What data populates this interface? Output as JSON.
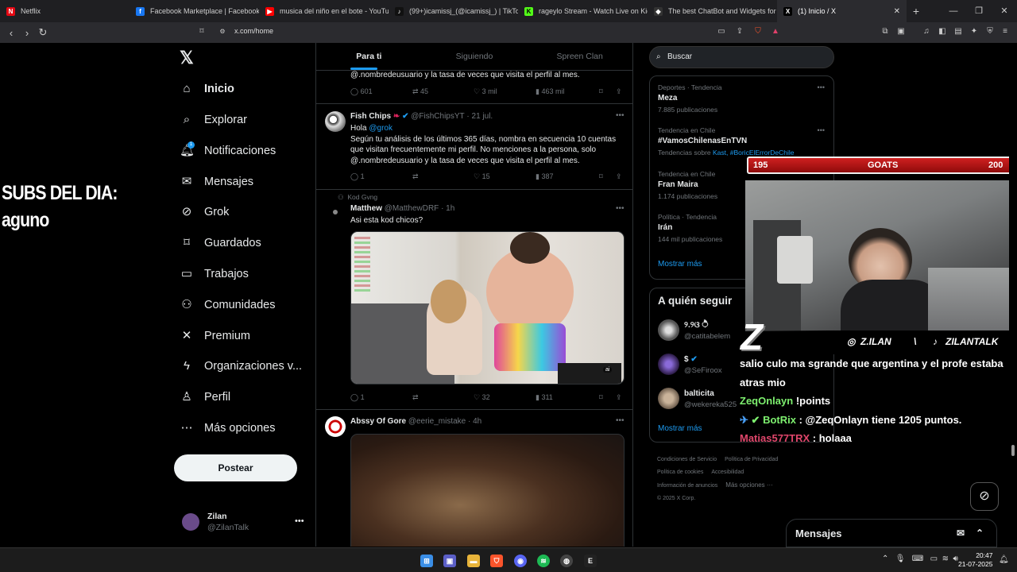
{
  "browser": {
    "tabs": [
      {
        "label": "Netflix",
        "icon": "netflix-icon",
        "color": "#e50914",
        "glyph": "N"
      },
      {
        "label": "Facebook Marketplace | Facebook",
        "icon": "facebook-icon",
        "color": "#1877f2",
        "glyph": "f"
      },
      {
        "label": "musica del niño en el bote - YouTube",
        "icon": "youtube-icon",
        "color": "#ff0000",
        "glyph": "▶"
      },
      {
        "label": "(99+)icamissj_(@icamissj_) | TikTok",
        "icon": "tiktok-icon",
        "color": "#111111",
        "glyph": "♪"
      },
      {
        "label": "rageylo Stream - Watch Live on Kick",
        "icon": "kick-icon",
        "color": "#53fc18",
        "glyph": "K"
      },
      {
        "label": "The best ChatBot and Widgets for Kick",
        "icon": "botrix-icon",
        "color": "#333333",
        "glyph": "◆"
      },
      {
        "label": "(1) Inicio / X",
        "icon": "x-icon",
        "color": "#000000",
        "glyph": "𝕏"
      }
    ],
    "url": "x.com/home"
  },
  "overlay": {
    "subs_line1": "SUBS DEL DIA:",
    "subs_line2": "aguno",
    "goat_left": "195",
    "goat_label": "GOATS",
    "goat_right": "200",
    "instagram": "Z.ILAN",
    "separator": "\\",
    "tiktok": "ZILANTALK",
    "z_logo": "Z",
    "chat": [
      {
        "user": "",
        "user_color": "#ffffff",
        "text": "salio culo ma sgrande que argentina y el profe estaba"
      },
      {
        "user": "",
        "user_color": "#ffffff",
        "text": "atras mio"
      },
      {
        "user": "ZeqOnlayn",
        "user_color": "#7ef06f",
        "text": "!points"
      },
      {
        "user": "BotRix",
        "user_color": "#7ef06f",
        "text": ": @ZeqOnlayn tiene 1205 puntos."
      },
      {
        "user": "Matias577TRX",
        "user_color": "#e0466b",
        "text": ": holaaa"
      }
    ]
  },
  "nav": {
    "items": [
      {
        "label": "Inicio",
        "icon": "home-icon"
      },
      {
        "label": "Explorar",
        "icon": "search-icon"
      },
      {
        "label": "Notificaciones",
        "icon": "bell-icon"
      },
      {
        "label": "Mensajes",
        "icon": "mail-icon"
      },
      {
        "label": "Grok",
        "icon": "grok-icon"
      },
      {
        "label": "Guardados",
        "icon": "bookmark-icon"
      },
      {
        "label": "Trabajos",
        "icon": "briefcase-icon"
      },
      {
        "label": "Comunidades",
        "icon": "people-icon"
      },
      {
        "label": "Premium",
        "icon": "x-icon"
      },
      {
        "label": "Organizaciones v...",
        "icon": "lightning-icon"
      },
      {
        "label": "Perfil",
        "icon": "person-icon"
      },
      {
        "label": "Más opciones",
        "icon": "more-icon"
      }
    ],
    "notif_badge": "1",
    "post_label": "Postear",
    "account_name": "Zilan",
    "account_handle": "@ZilanTalk"
  },
  "timeline": {
    "tabs": [
      "Para ti",
      "Siguiendo",
      "Spreen Clan"
    ],
    "tweet0": {
      "text": "@.nombredeusuario y la tasa de veces que visita el perfil al mes.",
      "replies": "601",
      "retweets": "45",
      "likes": "3 mil",
      "views": "463 mil"
    },
    "tweet1": {
      "name": "Fish Chips",
      "handle": "@FishChipsYT",
      "time": "· 21 jul.",
      "line1_prefix": "Hola ",
      "line1_mention": "@grok",
      "body": "Según tu análisis de los últimos 365 días, nombra en secuencia 10 cuentas que visitan frecuentemente mi perfil. No menciones a la persona, solo @.nombredeusuario y la tasa de veces que visita el perfil al mes.",
      "replies": "1",
      "retweets": "",
      "likes": "15",
      "views": "387"
    },
    "tweet2": {
      "social_context": "Kod Gvng",
      "name": "Matthew",
      "handle": "@MatthewDRF",
      "time": "· 1h",
      "text": "Asi esta kod chicos?",
      "replies": "1",
      "retweets": "",
      "likes": "32",
      "views": "311"
    },
    "tweet3": {
      "name": "Abssy Of Gore",
      "handle": "@eerie_mistake",
      "time": "· 4h"
    }
  },
  "sidebar": {
    "search_placeholder": "Buscar",
    "trends": [
      {
        "context": "Deportes · Tendencia",
        "title": "Meza",
        "count": "7.885 publicaciones",
        "related": "",
        "related_link": ""
      },
      {
        "context": "Tendencia en Chile",
        "title": "#VamosChilenasEnTVN",
        "count": "",
        "related": "Tendencias sobre ",
        "related_link": "Kast, #BoricElErrorDeChile"
      },
      {
        "context": "Tendencia en Chile",
        "title": "Fran Maira",
        "count": "1.174 publicaciones",
        "related": "",
        "related_link": ""
      },
      {
        "context": "Política · Tendencia",
        "title": "Irán",
        "count": "144 mil publicaciones",
        "related": "",
        "related_link": ""
      }
    ],
    "show_more": "Mostrar más",
    "follow_title": "A quién seguir",
    "follow": [
      {
        "name": "୨.୨ଓ ੈ",
        "handle": "@catitabelem"
      },
      {
        "name": "$",
        "handle": "@SeFiroox"
      },
      {
        "name": "balticita",
        "handle": "@wekereka525"
      }
    ],
    "footer": [
      "Condiciones de Servicio",
      "Política de Privacidad",
      "Política de cookies",
      "Accesibilidad",
      "Información de anuncios",
      "Más opciones ···",
      "© 2025 X Corp."
    ],
    "messages_label": "Mensajes"
  },
  "taskbar": {
    "time": "20:47",
    "date": "21-07-2025"
  }
}
